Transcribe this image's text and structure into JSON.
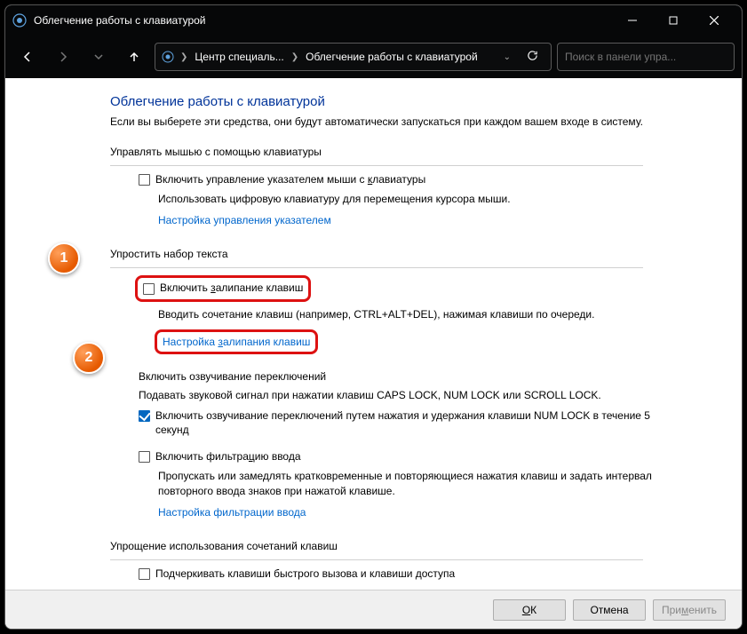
{
  "window": {
    "title": "Облегчение работы с клавиатурой"
  },
  "breadcrumb": {
    "item1": "Центр специаль...",
    "item2": "Облегчение работы с клавиатурой"
  },
  "search": {
    "placeholder": "Поиск в панели упра..."
  },
  "page": {
    "title": "Облегчение работы с клавиатурой",
    "subtitle": "Если вы выберете эти средства, они будут автоматически запускаться при каждом вашем входе в систему."
  },
  "mouse": {
    "group": "Управлять мышью с помощью клавиатуры",
    "chk_label_pre": "Включить управление указателем мыши с ",
    "chk_label_ul": "к",
    "chk_label_post": "лавиатуры",
    "desc": "Использовать цифровую клавиатуру для перемещения курсора мыши.",
    "link": "Настройка управления указателем"
  },
  "typing": {
    "group": "Упростить набор текста",
    "sticky_label_pre": "Включить ",
    "sticky_label_ul": "з",
    "sticky_label_post": "алипание клавиш",
    "sticky_desc": "Вводить сочетание клавиш (например, CTRL+ALT+DEL), нажимая клавиши по очереди.",
    "sticky_link_pre": "Настройка ",
    "sticky_link_ul": "з",
    "sticky_link_post": "алипания клавиш",
    "toggle_title": "Включить озвучивание переключений",
    "toggle_desc": "Подавать звуковой сигнал при нажатии клавиш CAPS LOCK, NUM LOCK или SCROLL LOCK.",
    "toggle_chk": "Включить озвучивание переключений путем нажатия и удержания клавиши NUM LOCK в течение 5 секунд",
    "filter_label_pre": "Включить фильтра",
    "filter_label_ul": "ц",
    "filter_label_post": "ию ввода",
    "filter_desc": "Пропускать или замедлять кратковременные и повторяющиеся нажатия клавиш и задать интервал повторного ввода знаков при нажатой клавише.",
    "filter_link": "Настройка фильтрации ввода"
  },
  "shortcuts": {
    "group": "Упрощение использования сочетаний клавиш",
    "chk_label_pre": "По",
    "chk_label_ul": "д",
    "chk_label_post": "черкивать клавиши быстрого вызова и клавиши доступа"
  },
  "footer": {
    "ok_ul": "О",
    "ok_post": "К",
    "cancel": "Отмена",
    "apply_pre": "При",
    "apply_ul": "м",
    "apply_post": "енить"
  },
  "callouts": {
    "c1": "1",
    "c2": "2"
  }
}
